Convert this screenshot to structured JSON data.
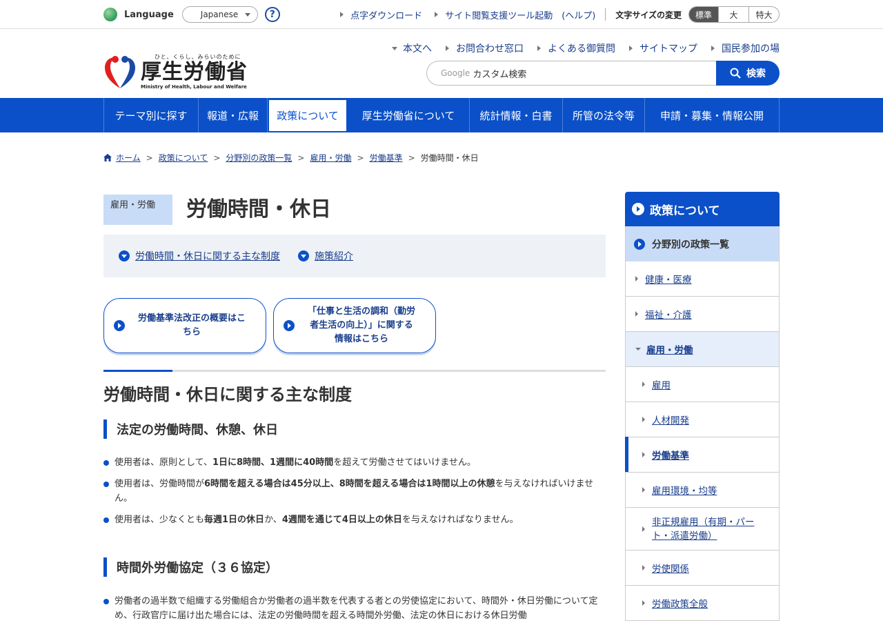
{
  "util": {
    "language_label": "Language",
    "language_value": "Japanese",
    "help": "?",
    "links": [
      "点字ダウンロード",
      "サイト閲覧支援ツール起動　(ヘルプ)"
    ],
    "font_size_label": "文字サイズの変更",
    "font_sizes": [
      "標準",
      "大",
      "特大"
    ]
  },
  "header": {
    "logo_tagline": "ひと、くらし、みらいのために",
    "logo_name": "厚生労働省",
    "logo_en": "Ministry of Health, Labour and Welfare",
    "links": [
      "本文へ",
      "お問合わせ窓口",
      "よくある御質問",
      "サイトマップ",
      "国民参加の場"
    ],
    "search_google": "Google",
    "search_placeholder": "カスタム検索",
    "search_button": "検索"
  },
  "gnav": [
    "テーマ別に探す",
    "報道・広報",
    "政策について",
    "厚生労働省について",
    "統計情報・白書",
    "所管の法令等",
    "申請・募集・情報公開"
  ],
  "breadcrumb": [
    "ホーム",
    "政策について",
    "分野別の政策一覧",
    "雇用・労働",
    "労働基準",
    "労働時間・休日"
  ],
  "main": {
    "category": "雇用・労働",
    "title": "労働時間・休日",
    "anchors": [
      "労働時間・休日に関する主な制度",
      "施策紹介"
    ],
    "buttons": [
      [
        "労働基準法改正の概要はこ",
        "ちら"
      ],
      [
        "「仕事と生活の調和（勤労",
        "者生活の向上）」に関する",
        "情報はこちら"
      ]
    ],
    "h2": "労働時間・休日に関する主な制度",
    "sec1_title": "法定の労働時間、休憩、休日",
    "sec1_items": [
      {
        "a": "使用者は、原則として、",
        "b": "1日に8時間、1週間に40時間",
        "c": "を超えて労働させてはいけません。"
      },
      {
        "a": "使用者は、労働時間が",
        "b": "6時間を超える場合は45分以上、8時間を超える場合は1時間以上の休憩",
        "c": "を与えなければいけません。"
      },
      {
        "a": "使用者は、少なくとも",
        "b": "毎週1日の休日",
        "c": "か、",
        "d": "4週間を通じて4日以上の休日",
        "e": "を与えなければなりません。"
      }
    ],
    "sec2_title": "時間外労働協定（３６協定）",
    "sec2_text": "労働者の過半数で組織する労働組合か労働者の過半数を代表する者との労使協定において、時間外・休日労働について定め、行政官庁に届け出た場合には、法定の労働時間を超える時間外労働、法定の休日における休日労働"
  },
  "side": {
    "head": "政策について",
    "sub": "分野別の政策一覧",
    "items": [
      "健康・医療",
      "福祉・介護",
      "雇用・労働"
    ],
    "children": [
      "雇用",
      "人材開発",
      "労働基準",
      "雇用環境・均等",
      "非正規雇用（有期・パー",
      "ト・派遣労働）",
      "労使関係",
      "労働政策全般"
    ]
  },
  "colors": {
    "brand": "#0b50c8",
    "link": "#1a3e8c",
    "badge": "#c9dcf7"
  }
}
